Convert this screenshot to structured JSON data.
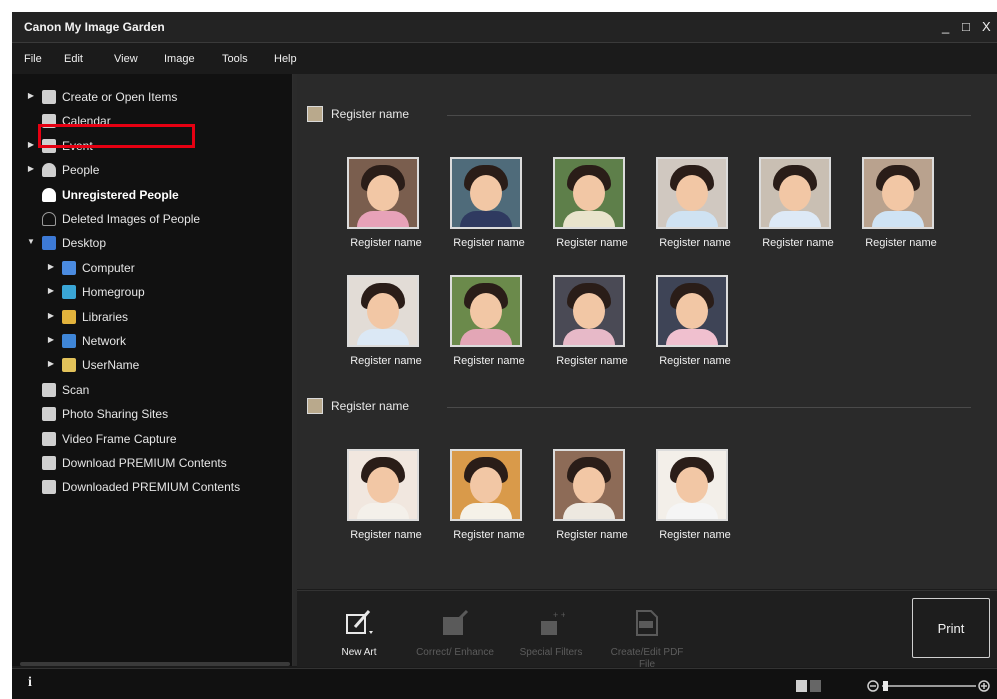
{
  "app": {
    "title": "Canon My Image Garden",
    "window_controls": {
      "minimize": "_",
      "maximize": "□",
      "close": "X"
    }
  },
  "menu": [
    "File",
    "Edit",
    "View",
    "Image",
    "Tools",
    "Help"
  ],
  "sidebar": {
    "items": [
      {
        "label": "Create or Open Items",
        "icon": "create-items-icon",
        "arrow": "right"
      },
      {
        "label": "Calendar",
        "icon": "calendar-icon",
        "arrow": ""
      },
      {
        "label": "Event",
        "icon": "event-icon",
        "arrow": "right"
      },
      {
        "label": "People",
        "icon": "people-icon",
        "arrow": "right"
      },
      {
        "label": "Unregistered People",
        "icon": "unregistered-people-icon",
        "arrow": "",
        "selected": true
      },
      {
        "label": "Deleted Images of People",
        "icon": "deleted-people-icon",
        "arrow": ""
      },
      {
        "label": "Desktop",
        "icon": "desktop-icon",
        "arrow": "down"
      },
      {
        "label": "Computer",
        "icon": "computer-icon",
        "arrow": "right",
        "indent": 1
      },
      {
        "label": "Homegroup",
        "icon": "homegroup-icon",
        "arrow": "right",
        "indent": 1
      },
      {
        "label": "Libraries",
        "icon": "libraries-icon",
        "arrow": "right",
        "indent": 1
      },
      {
        "label": "Network",
        "icon": "network-icon",
        "arrow": "right",
        "indent": 1
      },
      {
        "label": "UserName",
        "icon": "user-folder-icon",
        "arrow": "right",
        "indent": 1
      },
      {
        "label": "Scan",
        "icon": "scan-icon",
        "arrow": ""
      },
      {
        "label": "Photo Sharing Sites",
        "icon": "photo-sharing-icon",
        "arrow": ""
      },
      {
        "label": "Video Frame Capture",
        "icon": "video-capture-icon",
        "arrow": ""
      },
      {
        "label": "Download PREMIUM Contents",
        "icon": "download-premium-icon",
        "arrow": ""
      },
      {
        "label": "Downloaded PREMIUM Contents",
        "icon": "downloaded-premium-icon",
        "arrow": ""
      }
    ]
  },
  "groups": [
    {
      "heading": "Register name",
      "thumbs": [
        {
          "caption": "Register name",
          "bg": "#7a5e4e",
          "shirt": "#e7a2b8"
        },
        {
          "caption": "Register name",
          "bg": "#4f6b7a",
          "shirt": "#2f3a60"
        },
        {
          "caption": "Register name",
          "bg": "#5e7f4a",
          "shirt": "#e9e4cc"
        },
        {
          "caption": "Register name",
          "bg": "#d0c8c0",
          "shirt": "#cfe2f2"
        },
        {
          "caption": "Register name",
          "bg": "#c9bfb3",
          "shirt": "#dde9f6"
        },
        {
          "caption": "Register name",
          "bg": "#b9a28e",
          "shirt": "#cfe3f4"
        },
        {
          "caption": "Register name",
          "bg": "#e2dcd6",
          "shirt": "#dbe8f5"
        },
        {
          "caption": "Register name",
          "bg": "#6b8a4b",
          "shirt": "#e3a6b6"
        },
        {
          "caption": "Register name",
          "bg": "#4a4a55",
          "shirt": "#e7b9c8"
        },
        {
          "caption": "Register name",
          "bg": "#3e4456",
          "shirt": "#f0c0cf"
        }
      ]
    },
    {
      "heading": "Register name",
      "thumbs": [
        {
          "caption": "Register name",
          "bg": "#f1e7df",
          "shirt": "#f4f0ea"
        },
        {
          "caption": "Register name",
          "bg": "#d99a4a",
          "shirt": "#f5f1e8"
        },
        {
          "caption": "Register name",
          "bg": "#8d6b57",
          "shirt": "#ede8e0"
        },
        {
          "caption": "Register name",
          "bg": "#f3efe9",
          "shirt": "#f5f5f5"
        }
      ]
    }
  ],
  "toolbar": {
    "tools": [
      {
        "label": "New Art",
        "enabled": true,
        "icon": "new-art-icon"
      },
      {
        "label": "Correct/ Enhance",
        "enabled": false,
        "icon": "correct-enhance-icon"
      },
      {
        "label": "Special Filters",
        "enabled": false,
        "icon": "special-filters-icon"
      },
      {
        "label": "Create/Edit PDF File",
        "enabled": false,
        "icon": "pdf-file-icon"
      }
    ],
    "print_label": "Print"
  },
  "status": {
    "info": "i"
  },
  "colors": {
    "selection_highlight": "#e60012",
    "background": "#1b1b1b"
  }
}
